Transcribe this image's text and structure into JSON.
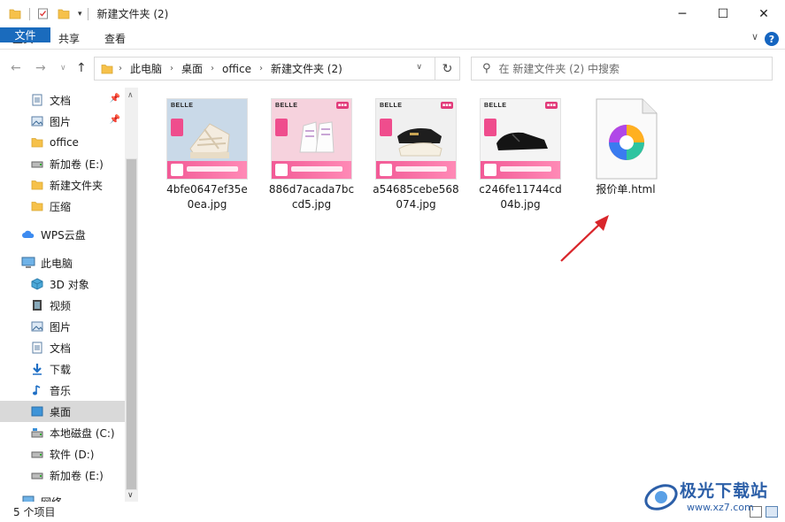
{
  "window": {
    "title": "新建文件夹 (2)",
    "controls": {
      "minimize": "─",
      "maximize": "☐",
      "close": "✕"
    }
  },
  "ribbon": {
    "tabs": [
      "文件",
      "主页",
      "共享",
      "查看"
    ],
    "help": "?"
  },
  "address": {
    "crumbs": [
      "此电脑",
      "桌面",
      "office",
      "新建文件夹 (2)"
    ]
  },
  "search": {
    "placeholder": "在 新建文件夹 (2) 中搜索"
  },
  "nav": {
    "items": [
      {
        "label": "文档",
        "icon": "document-icon",
        "pinned": true
      },
      {
        "label": "图片",
        "icon": "picture-icon",
        "pinned": true
      },
      {
        "label": "office",
        "icon": "folder-icon"
      },
      {
        "label": "新加卷 (E:)",
        "icon": "drive-icon"
      },
      {
        "label": "新建文件夹",
        "icon": "folder-icon"
      },
      {
        "label": "压缩",
        "icon": "folder-icon"
      },
      {
        "label": "WPS云盘",
        "icon": "cloud-icon"
      },
      {
        "label": "此电脑",
        "icon": "computer-icon"
      },
      {
        "label": "3D 对象",
        "icon": "cube-icon"
      },
      {
        "label": "视频",
        "icon": "video-icon"
      },
      {
        "label": "图片",
        "icon": "picture-icon"
      },
      {
        "label": "文档",
        "icon": "document-icon"
      },
      {
        "label": "下载",
        "icon": "download-icon"
      },
      {
        "label": "音乐",
        "icon": "music-icon"
      },
      {
        "label": "桌面",
        "icon": "desktop-icon",
        "selected": true
      },
      {
        "label": "本地磁盘 (C:)",
        "icon": "drive-icon"
      },
      {
        "label": "软件 (D:)",
        "icon": "drive-icon"
      },
      {
        "label": "新加卷 (E:)",
        "icon": "drive-icon"
      },
      {
        "label": "网络",
        "icon": "network-icon"
      }
    ]
  },
  "files": [
    {
      "name": "4bfe0647ef35e0ea.jpg",
      "brand": "BELLE",
      "bg": "#c9d9e8"
    },
    {
      "name": "886d7acada7bccd5.jpg",
      "brand": "BELLE",
      "bg": "#f6d2dd"
    },
    {
      "name": "a54685cebe568074.jpg",
      "brand": "BELLE",
      "bg": "#f0f0f0"
    },
    {
      "name": "c246fe11744cd04b.jpg",
      "brand": "BELLE",
      "bg": "#f4f4f4"
    },
    {
      "name": "报价单.html",
      "icon": "browser-html-icon"
    }
  ],
  "status": {
    "count": "5 个项目"
  },
  "watermark": {
    "title": "极光下载站",
    "url": "www.xz7.com"
  },
  "colors": {
    "accent": "#1a6bbd",
    "arrow": "#d9262b",
    "selection": "#d9d9d9"
  }
}
